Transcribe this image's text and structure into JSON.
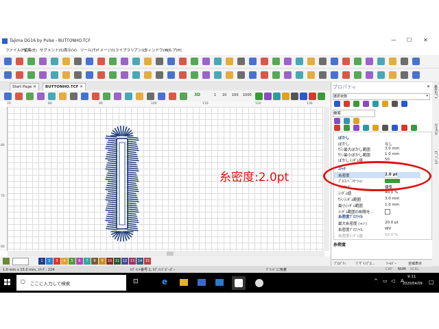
{
  "window": {
    "title": "Tajima DG16 by Pulse - BUTTONHO.TCF"
  },
  "menu": [
    "ファイル(F)",
    "編集(E)",
    "セグメント(S)",
    "表示(V)",
    "ツール(T)",
    "イメージ(I)",
    "ライブラリアン(L)",
    "ウィンドウ(W)",
    "ヘルプ(H)"
  ],
  "tabs": {
    "start": "Start Page",
    "doc": "BUTTONHO.TCF"
  },
  "toolbar": {
    "num_tools": [
      "1",
      "10",
      "100",
      "1000"
    ],
    "threed": "3D"
  },
  "ruler": {
    "top": [
      "70",
      "80",
      "90",
      "100",
      "110",
      "120",
      "130"
    ],
    "left": [
      "80",
      "70",
      "60"
    ]
  },
  "palette": {
    "swatches": [
      {
        "n": "1",
        "c": "#1f3e8c"
      },
      {
        "n": "2",
        "c": "#2b7fd4"
      },
      {
        "n": "3",
        "c": "#d23c2c"
      },
      {
        "n": "4",
        "c": "#e8a030"
      },
      {
        "n": "5",
        "c": "#5a9a3c"
      },
      {
        "n": "6",
        "c": "#b04ab0"
      },
      {
        "n": "7",
        "c": "#30a8a0"
      },
      {
        "n": "8",
        "c": "#7a5a3a"
      },
      {
        "n": "9",
        "c": "#c89028"
      },
      {
        "n": "10",
        "c": "#8a2a2a"
      },
      {
        "n": "11",
        "c": "#2a5a2a"
      },
      {
        "n": "12",
        "c": "#4a4a9a"
      },
      {
        "n": "13",
        "c": "#a03060"
      },
      {
        "n": "14",
        "c": "#306080"
      },
      {
        "n": "15",
        "c": "#c04040"
      }
    ]
  },
  "status": {
    "size": "1.0 mm x 15.0 mm, ｽﾃｯﾁ : 224",
    "seg": "ｾｸﾞﾒﾝﾄ番号:1, ｾｸﾞﾒﾝﾄﾞﾎﾞｰﾀﾞｰ",
    "grid": "ｸﾞﾘｯﾄﾞに吸着",
    "caps": "CAP",
    "num": "NUM",
    "scrl": "SCRL"
  },
  "props": {
    "header": "プロパティ",
    "category": "選択状態",
    "search_value": "検索",
    "sections": {
      "blur": "ぼかし",
      "sub": "ｽﾃｯﾁ",
      "profile": "糸密度ﾌﾟﾛﾌｧｲﾙ"
    },
    "rows": [
      {
        "k": "ぼかし",
        "v": "なし"
      },
      {
        "k": "ｻﾃﾝ最大ぼかし範囲",
        "v": "3.0 mm"
      },
      {
        "k": "ｻﾃﾝ最小ぼかし範囲",
        "v": "1.0 mm"
      },
      {
        "k": "ぼかしﾗﾝﾀﾞﾑ値",
        "v": "50"
      },
      {
        "k": "糸密度",
        "v": "2.0 pt"
      },
      {
        "k": "ﾌﾟﾙｺﾝﾍﾟﾝｾｰｼｮﾝ",
        "v": ""
      },
      {
        "k": "ﾌｨﾙﾀｲﾌﾟ",
        "v": "標準"
      },
      {
        "k": "ﾗﾝﾀﾞﾑ値",
        "v": "40.0 %"
      },
      {
        "k": "ｻﾃﾝﾗﾝﾀﾞﾑ範囲",
        "v": "3.0 mm"
      },
      {
        "k": "最小ﾗﾝﾀﾞﾑ範囲",
        "v": "1.0 mm"
      },
      {
        "k": "ﾗﾝﾀﾞﾑ範囲の制限を..",
        "v": ""
      },
      {
        "k": "最大糸密度 (+/-)",
        "v": "20.0 pt"
      },
      {
        "k": "糸密度ﾌﾟﾛﾌｧｲﾙ",
        "v": "WV"
      },
      {
        "k": "糸密度ﾗﾝﾀﾞﾑ値",
        "v": "50.0 %"
      }
    ],
    "desc_title": "糸密度",
    "bottom_tabs": [
      "ﾌﾟﾛﾊﾟﾃｨ",
      "ﾃﾞｻﾞｲﾝﾌﾟﾛ...",
      "ﾂｰﾙﾊﾞｰ",
      "全域表示"
    ]
  },
  "sidetabs": [
    "表示ﾓﾃﾞﾙ",
    "ｽﾃｯﾁﾘｽﾄ",
    "ｵﾌﾞｼﾞｪｸﾄ"
  ],
  "annotation": {
    "text": "糸密度:2.0pt",
    "color": "#e01010"
  },
  "taskbar": {
    "search_placeholder": "ここに入力して検索",
    "time": "9:11",
    "date": "2020/04/09"
  }
}
